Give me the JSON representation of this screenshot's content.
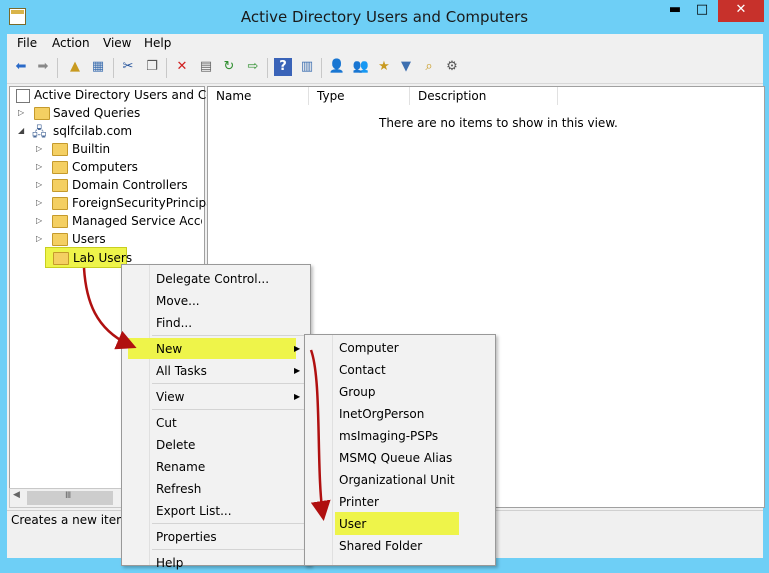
{
  "window": {
    "title": "Active Directory Users and Computers",
    "min": "▬",
    "max": "□",
    "close": "✕"
  },
  "menu": [
    "File",
    "Action",
    "View",
    "Help"
  ],
  "toolbar_icons": [
    "back-icon",
    "forward-icon",
    "up-folder-icon",
    "show-hide-tree-icon",
    "cut-icon",
    "copy-icon",
    "delete-icon",
    "properties-icon",
    "refresh-icon",
    "export-icon",
    "help-icon",
    "action-pane-icon",
    "new-user-icon",
    "new-group-icon",
    "new-ou-icon",
    "filter-icon",
    "find-icon",
    "delegate-icon"
  ],
  "tree": {
    "root": "Active Directory Users and Com",
    "saved_queries": "Saved Queries",
    "domain": "sqlfcilab.com",
    "children": [
      "Builtin",
      "Computers",
      "Domain Controllers",
      "ForeignSecurityPrincipals",
      "Managed Service Accour",
      "Users",
      "Lab Users"
    ]
  },
  "list": {
    "columns": [
      "Name",
      "Type",
      "Description"
    ],
    "empty_text": "There are no items to show in this view."
  },
  "status": "Creates a new item in",
  "context_menu": {
    "items": [
      "Delegate Control...",
      "Move...",
      "Find...",
      "New",
      "All Tasks",
      "View",
      "Cut",
      "Delete",
      "Rename",
      "Refresh",
      "Export List...",
      "Properties",
      "Help"
    ]
  },
  "submenu": {
    "items": [
      "Computer",
      "Contact",
      "Group",
      "InetOrgPerson",
      "msImaging-PSPs",
      "MSMQ Queue Alias",
      "Organizational Unit",
      "Printer",
      "User",
      "Shared Folder"
    ]
  },
  "highlight_color": "#eef44a",
  "arrow_color": "#b01010"
}
